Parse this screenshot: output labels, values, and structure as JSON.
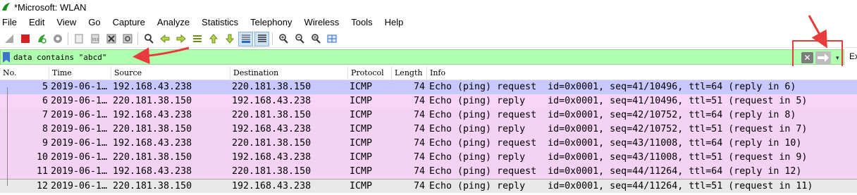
{
  "window": {
    "title": "*Microsoft: WLAN"
  },
  "menu": [
    "File",
    "Edit",
    "View",
    "Go",
    "Capture",
    "Analyze",
    "Statistics",
    "Telephony",
    "Wireless",
    "Tools",
    "Help"
  ],
  "toolbar": {
    "icons": [
      "shark-fin-icon",
      "stop-capture-icon",
      "restart-capture-icon",
      "capture-options-icon",
      "open-file-icon",
      "save-file-icon",
      "close-file-icon",
      "reload-file-icon",
      "find-packet-icon",
      "go-back-icon",
      "go-forward-icon",
      "go-to-packet-icon",
      "first-packet-icon",
      "last-packet-icon",
      "auto-scroll-icon",
      "colorize-icon",
      "zoom-in-icon",
      "zoom-out-icon",
      "normal-size-icon",
      "resize-columns-icon"
    ]
  },
  "filter": {
    "value": "data contains \"abcd\"",
    "clear_label": "✕",
    "expression_label": "Ex"
  },
  "columns": [
    "No.",
    "Time",
    "Source",
    "Destination",
    "Protocol",
    "Length",
    "Info"
  ],
  "packets": [
    {
      "no": "5",
      "time": "2019-06-1…",
      "src": "192.168.43.238",
      "dst": "220.181.38.150",
      "proto": "ICMP",
      "len": "74",
      "info": "Echo (ping) request  id=0x0001, seq=41/10496, ttl=64 (reply in 6)",
      "kind": "request"
    },
    {
      "no": "6",
      "time": "2019-06-1…",
      "src": "220.181.38.150",
      "dst": "192.168.43.238",
      "proto": "ICMP",
      "len": "74",
      "info": "Echo (ping) reply    id=0x0001, seq=41/10496, ttl=51 (request in 5)",
      "kind": "reply"
    },
    {
      "no": "7",
      "time": "2019-06-1…",
      "src": "192.168.43.238",
      "dst": "220.181.38.150",
      "proto": "ICMP",
      "len": "74",
      "info": "Echo (ping) request  id=0x0001, seq=42/10752, ttl=64 (reply in 8)",
      "kind": "alt"
    },
    {
      "no": "8",
      "time": "2019-06-1…",
      "src": "220.181.38.150",
      "dst": "192.168.43.238",
      "proto": "ICMP",
      "len": "74",
      "info": "Echo (ping) reply    id=0x0001, seq=42/10752, ttl=51 (request in 7)",
      "kind": "alt"
    },
    {
      "no": "9",
      "time": "2019-06-1…",
      "src": "192.168.43.238",
      "dst": "220.181.38.150",
      "proto": "ICMP",
      "len": "74",
      "info": "Echo (ping) request  id=0x0001, seq=43/11008, ttl=64 (reply in 10)",
      "kind": "alt"
    },
    {
      "no": "10",
      "time": "2019-06-1…",
      "src": "220.181.38.150",
      "dst": "192.168.43.238",
      "proto": "ICMP",
      "len": "74",
      "info": "Echo (ping) reply    id=0x0001, seq=43/11008, ttl=51 (request in 9)",
      "kind": "alt"
    },
    {
      "no": "11",
      "time": "2019-06-1…",
      "src": "192.168.43.238",
      "dst": "220.181.38.150",
      "proto": "ICMP",
      "len": "74",
      "info": "Echo (ping) request  id=0x0001, seq=44/11264, ttl=64 (reply in 12)",
      "kind": "alt"
    },
    {
      "no": "12",
      "time": "2019-06-1…",
      "src": "220.181.38.150",
      "dst": "192.168.43.238",
      "proto": "ICMP",
      "len": "74",
      "info": "Echo (ping) reply    id=0x0001, seq=44/11264, ttl=51 (request in 11)",
      "kind": "selected"
    }
  ],
  "colors": {
    "filter_ok": "#afffaf",
    "icmp_request": "#c8c8ff",
    "icmp_reply": "#f8d4f8",
    "annotation": "#e83b3b"
  }
}
